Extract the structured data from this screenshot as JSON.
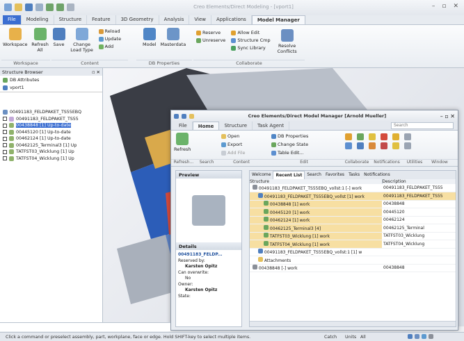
{
  "app": {
    "title": "Creo Elements/Direct Modeling - [vport1]"
  },
  "qat_icons": [
    "new-icon",
    "open-icon",
    "save-icon",
    "print-icon",
    "undo-icon",
    "redo-icon",
    "customize-icon"
  ],
  "tabs": [
    "File",
    "Modeling",
    "Structure",
    "Feature",
    "3D Geometry",
    "Analysis",
    "View",
    "Applications",
    "Model Manager"
  ],
  "active_tab": "Model Manager",
  "ribbon": {
    "workspace": {
      "workspace": "Workspace",
      "refresh": "Refresh All",
      "save": "Save",
      "change": "Change Load Type",
      "reload": "Reload",
      "update": "Update",
      "add": "Add",
      "group_workspace": "Workspace",
      "group_content": "Content"
    },
    "db": {
      "model": "Model",
      "masterdata": "Masterdata",
      "group": "DB Properties"
    },
    "collab": {
      "reserve": "Reserve",
      "unreserve": "Unreserve",
      "allow_edit": "Allow Edit",
      "structure_cmp": "Structure Cmp",
      "sync_library": "Sync Library",
      "resolve": "Resolve Conflicts",
      "group": "Collaborate"
    }
  },
  "structure_browser": {
    "title": "Structure Browser",
    "db_attributes": "DB Attributes",
    "vport": "vport1",
    "items": [
      "00491183_FELDPAKET_TS55EBQ",
      "00491183_FELDPAKET_TS55",
      "00438848 [1] Up-to-date",
      "00445120 [1] Up-to-date",
      "00462124 [1] Up-to-date",
      "00462125_Terminal3 [1] Up",
      "TATFST03_Wicklung [1] Up",
      "TATFST04_Wicklung [1] Up"
    ]
  },
  "model_manager": {
    "title": "Creo Elements/Direct Model Manager [Arnold Mueller]",
    "tabs": [
      "File",
      "Home",
      "Structure",
      "Task Agent"
    ],
    "search_placeholder": "Search",
    "ribbon": {
      "refresh": "Refresh",
      "open": "Open",
      "export": "Export",
      "add_file": "Add File",
      "db_properties": "DB Properties",
      "change_state": "Change State",
      "table_edit": "Table Edit...",
      "groups": [
        "Refresh...",
        "Search",
        "Content",
        "Edit",
        "Collaborate",
        "Notifications",
        "Utilities",
        "Window"
      ]
    },
    "panel_tabs": [
      "Welcome",
      "Recent List",
      "Search",
      "Favorites",
      "Tasks",
      "Notifications"
    ],
    "active_panel_tab": "Recent List",
    "preview_label": "Preview",
    "details": {
      "label": "Details",
      "name": "00491183_FELDP...",
      "reserved_by_label": "Reserved by:",
      "reserved_by": "Karsten Opitz",
      "can_overwrite_label": "Can overwrite:",
      "can_overwrite": "No",
      "owner_label": "Owner:",
      "owner": "Karsten Opitz",
      "state_label": "State:"
    },
    "columns": [
      "Structure",
      "Description"
    ],
    "rows": [
      {
        "structure": "00491183_FELDPAKET_TS55EBQ_vollst:1 [-] work",
        "description": "00491183_FELDPAKET_TS55"
      },
      {
        "structure": "00491183_FELDPAKET_TS55EBQ_vollst [1] work",
        "description": "00491183_FELDPAKET_TS55"
      },
      {
        "structure": "00438848 [1] work",
        "description": "00438848"
      },
      {
        "structure": "00445120 [1] work",
        "description": "00445120"
      },
      {
        "structure": "00462124 [1] work",
        "description": "00462124"
      },
      {
        "structure": "00462125_Terminal3 [4]",
        "description": "00462125_Terminal"
      },
      {
        "structure": "TATFST03_Wicklung [1] work",
        "description": "TATFST03_Wicklung"
      },
      {
        "structure": "TATFST04_Wicklung [1] work",
        "description": "TATFST04_Wicklung"
      },
      {
        "structure": "00491183_FELDPAKET_TS55EBQ_vollst:1 [1] w",
        "description": ""
      },
      {
        "structure": "Attachments",
        "description": ""
      },
      {
        "structure": "00438848 [-] work",
        "description": "00438848"
      }
    ]
  },
  "status": {
    "message": "Click a command or preselect assembly, part, workplane, face or edge. Hold SHIFT-key to select multiple items.",
    "catch": "Catch",
    "units": "Units",
    "units_value": "All"
  }
}
